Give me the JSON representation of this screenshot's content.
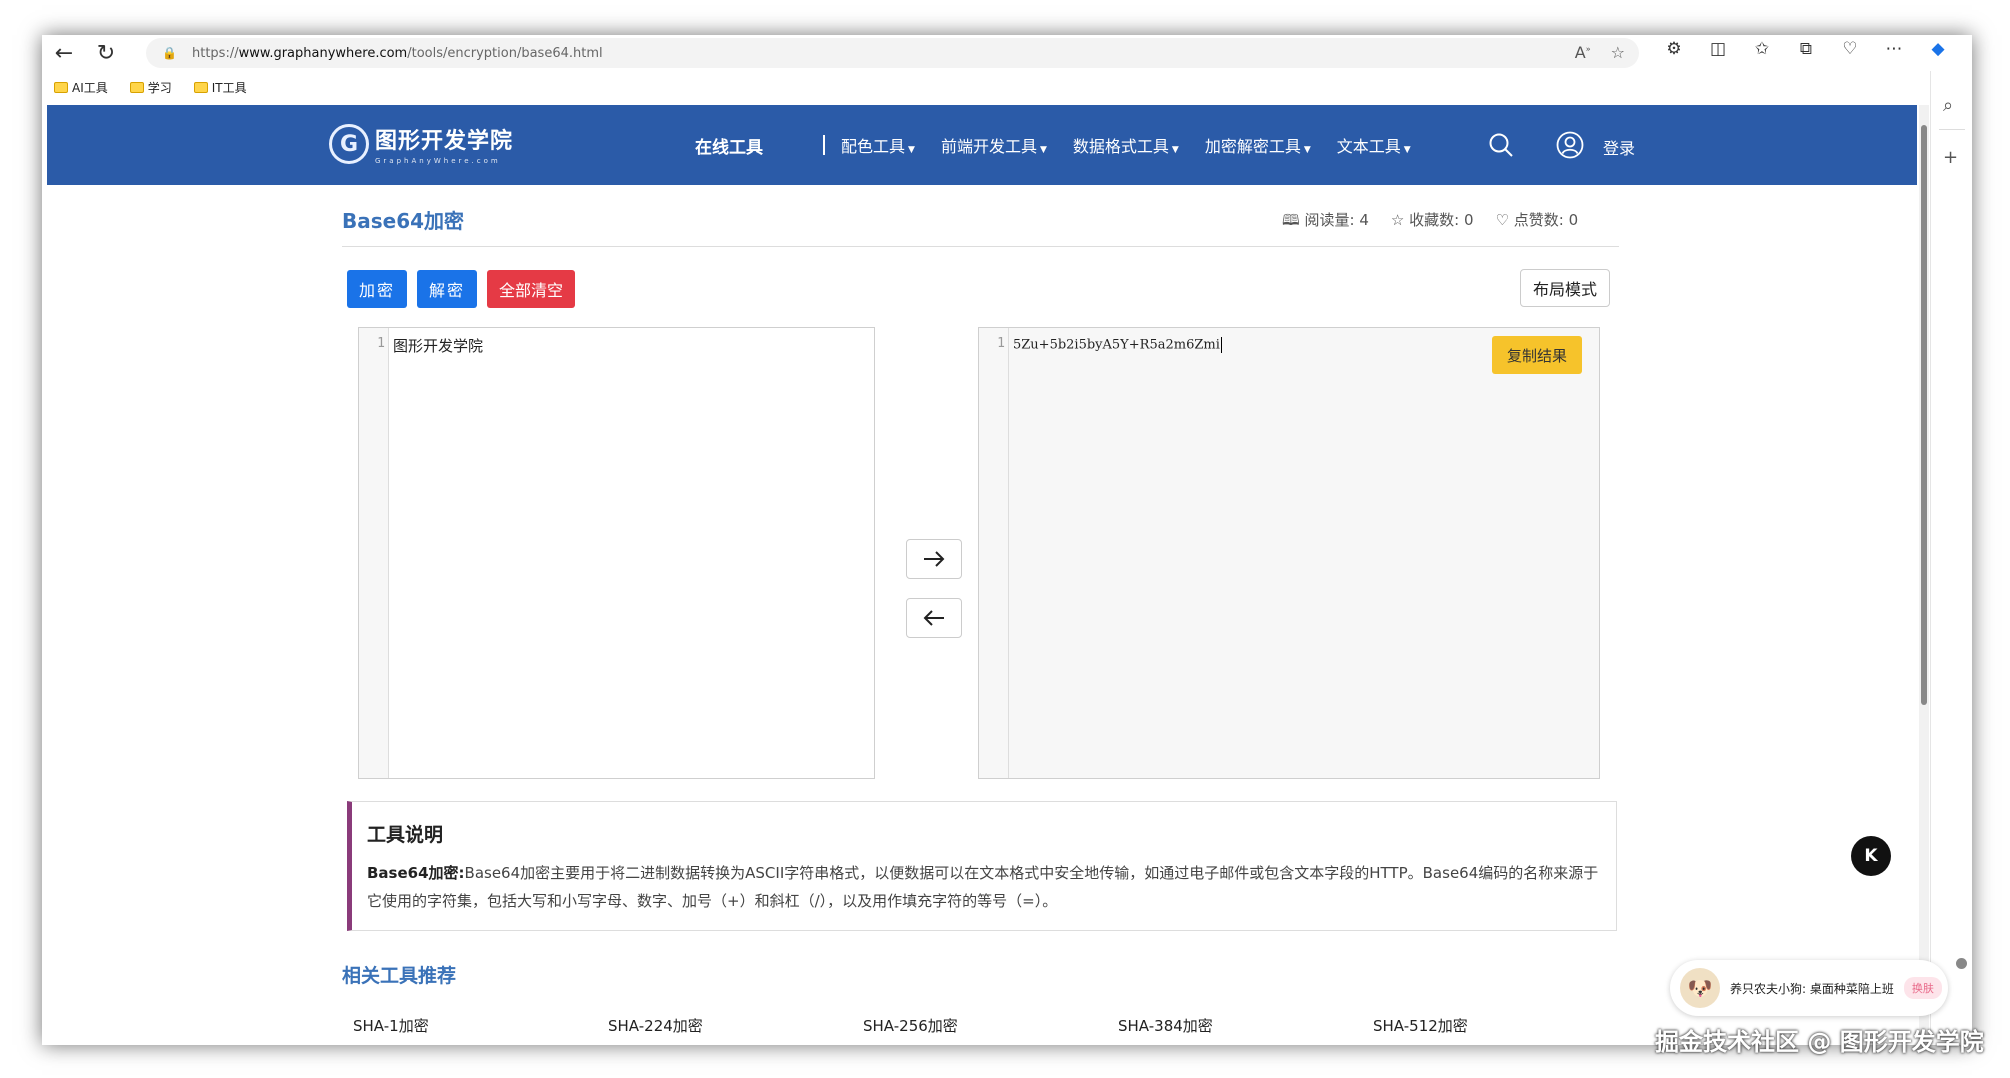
{
  "browser": {
    "url_proto": "https://",
    "url_host": "www.graphanywhere.com",
    "url_path": "/tools/encryption/base64.html",
    "bookmarks": [
      "AI工具",
      "学习",
      "IT工具"
    ]
  },
  "header": {
    "logo_name": "图形开发学院",
    "logo_sub": "GraphAnyWhere.com",
    "nav_online": "在线工具",
    "nav_items": [
      "配色工具",
      "前端开发工具",
      "数据格式工具",
      "加密解密工具",
      "文本工具"
    ],
    "login": "登录"
  },
  "page": {
    "title": "Base64加密",
    "stats": {
      "views_label": "阅读量:",
      "views": "4",
      "favorites_label": "收藏数:",
      "favorites": "0",
      "likes_label": "点赞数:",
      "likes": "0"
    },
    "buttons": {
      "encrypt": "加密",
      "decrypt": "解密",
      "clear_all": "全部清空",
      "layout": "布局模式",
      "copy_result": "复制结果"
    },
    "input_editor": {
      "line_number": "1",
      "text": "图形开发学院"
    },
    "output_editor": {
      "line_number": "1",
      "text": "5Zu+5b2i5byA5Y+R5a2m6Zmi"
    },
    "description": {
      "heading": "工具说明",
      "lead": "Base64加密:",
      "body": "Base64加密主要用于将二进制数据转换为ASCII字符串格式，以便数据可以在文本格式中安全地传输，如通过电子邮件或包含文本字段的HTTP。Base64编码的名称来源于它使用的字符集，包括大写和小写字母、数字、加号（+）和斜杠（/），以及用作填充字符的等号（=）。"
    },
    "related": {
      "title": "相关工具推荐",
      "items": [
        "SHA-1加密",
        "SHA-224加密",
        "SHA-256加密",
        "SHA-384加密",
        "SHA-512加密"
      ]
    }
  },
  "widgets": {
    "k_badge": "K",
    "chat_text": "养只农夫小狗: 桌面种菜陪上班",
    "chat_switch": "换肤"
  },
  "watermark": "掘金技术社区 @ 图形开发学院"
}
